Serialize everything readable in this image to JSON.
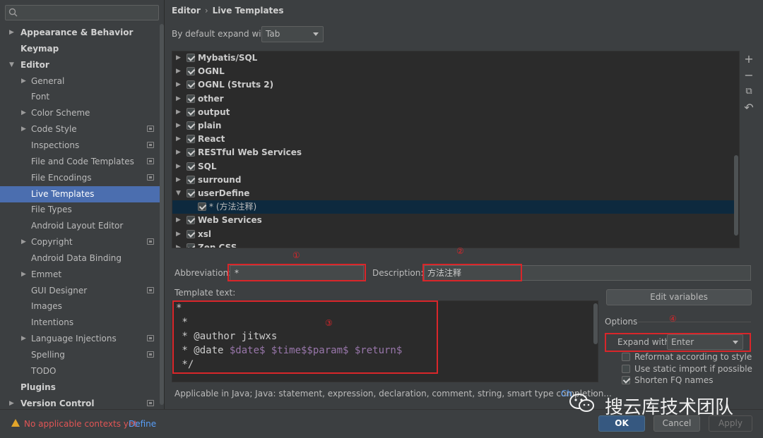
{
  "search": {
    "placeholder": ""
  },
  "sidebar": {
    "items": [
      {
        "label": "Appearance & Behavior",
        "arrow": "▶",
        "bold": true
      },
      {
        "label": "Keymap",
        "bold": true
      },
      {
        "label": "Editor",
        "arrow": "▼",
        "bold": true
      },
      {
        "label": "General",
        "arrow": "▶"
      },
      {
        "label": "Font"
      },
      {
        "label": "Color Scheme",
        "arrow": "▶"
      },
      {
        "label": "Code Style",
        "arrow": "▶",
        "project_icon": true
      },
      {
        "label": "Inspections",
        "project_icon": true
      },
      {
        "label": "File and Code Templates",
        "project_icon": true
      },
      {
        "label": "File Encodings",
        "project_icon": true
      },
      {
        "label": "Live Templates",
        "selected": true
      },
      {
        "label": "File Types"
      },
      {
        "label": "Android Layout Editor"
      },
      {
        "label": "Copyright",
        "arrow": "▶",
        "project_icon": true
      },
      {
        "label": "Android Data Binding"
      },
      {
        "label": "Emmet",
        "arrow": "▶"
      },
      {
        "label": "GUI Designer",
        "project_icon": true
      },
      {
        "label": "Images"
      },
      {
        "label": "Intentions"
      },
      {
        "label": "Language Injections",
        "arrow": "▶",
        "project_icon": true
      },
      {
        "label": "Spelling",
        "project_icon": true
      },
      {
        "label": "TODO"
      },
      {
        "label": "Plugins",
        "bold": true
      },
      {
        "label": "Version Control",
        "arrow": "▶",
        "bold": true,
        "project_icon": true
      }
    ]
  },
  "breadcrumb": {
    "parent": "Editor",
    "separator": "›",
    "current": "Live Templates"
  },
  "expand_default": {
    "label": "By default expand with",
    "value": "Tab"
  },
  "template_groups": [
    {
      "name": "Mybatis/SQL",
      "arrow": "▶"
    },
    {
      "name": "OGNL",
      "arrow": "▶"
    },
    {
      "name": "OGNL (Struts 2)",
      "arrow": "▶"
    },
    {
      "name": "other",
      "arrow": "▶"
    },
    {
      "name": "output",
      "arrow": "▶"
    },
    {
      "name": "plain",
      "arrow": "▶"
    },
    {
      "name": "React",
      "arrow": "▶"
    },
    {
      "name": "RESTful Web Services",
      "arrow": "▶"
    },
    {
      "name": "SQL",
      "arrow": "▶"
    },
    {
      "name": "surround",
      "arrow": "▶"
    },
    {
      "name": "userDefine",
      "arrow": "▼"
    },
    {
      "name": "* (方法注释)",
      "child": true
    },
    {
      "name": "Web Services",
      "arrow": "▶"
    },
    {
      "name": "xsl",
      "arrow": "▶"
    },
    {
      "name": "Zen CSS",
      "arrow": "▶"
    }
  ],
  "side_tools": {
    "add": "+",
    "remove": "−",
    "copy": "⧉",
    "revert": "↶"
  },
  "abbreviation": {
    "label": "Abbreviation:",
    "value": "*"
  },
  "description": {
    "label": "Description:",
    "value": "方法注释"
  },
  "template_text": {
    "label": "Template text:",
    "lines": [
      {
        "plain": "*"
      },
      {
        "plain": " *"
      },
      {
        "plain": " * @author jitwxs"
      },
      {
        "plain": " * @date ",
        "vars": "$date$ $time$$param$ $return$"
      },
      {
        "plain": " */"
      }
    ]
  },
  "applicable": {
    "text": "Applicable in Java; Java: statement, expression, declaration, comment, string, smart type completion...",
    "link": "Ch",
    "caret": "⌄"
  },
  "edit_variables": "Edit variables",
  "options": {
    "label": "Options",
    "expand_with_label": "Expand with",
    "expand_with_value": "Enter",
    "checkboxes": [
      {
        "label": "Reformat according to style",
        "checked": false
      },
      {
        "label": "Use static import if possible",
        "checked": false
      },
      {
        "label": "Shorten FQ names",
        "checked": true
      }
    ]
  },
  "annotations": {
    "one": "①",
    "two": "②",
    "three": "③",
    "four": "④",
    "color": "#d9262a"
  },
  "footer": {
    "warning": "No applicable contexts yet.",
    "define_link": "Define",
    "ok": "OK",
    "cancel": "Cancel",
    "apply": "Apply"
  },
  "watermark": {
    "text": "搜云库技术团队"
  },
  "colors": {
    "selection": "#4b6eaf",
    "accent_link": "#589df6",
    "ok_button": "#365880",
    "warning_text": "#e05555"
  }
}
